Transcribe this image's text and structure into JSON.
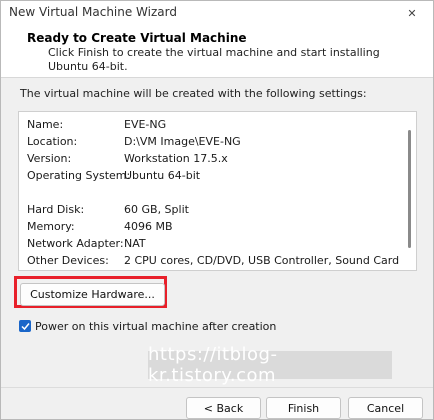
{
  "window": {
    "title": "New Virtual Machine Wizard",
    "close_glyph": "✕"
  },
  "header": {
    "title": "Ready to Create Virtual Machine",
    "subtitle": "Click Finish to create the virtual machine and start installing Ubuntu 64-bit."
  },
  "intro": "The virtual machine will be created with the following settings:",
  "settings": [
    {
      "label": "Name:",
      "value": "EVE-NG"
    },
    {
      "label": "Location:",
      "value": "D:\\VM Image\\EVE-NG"
    },
    {
      "label": "Version:",
      "value": "Workstation 17.5.x"
    },
    {
      "label": "Operating System:",
      "value": "Ubuntu 64-bit"
    },
    {
      "label": "Hard Disk:",
      "value": "60 GB, Split"
    },
    {
      "label": "Memory:",
      "value": "4096 MB"
    },
    {
      "label": "Network Adapter:",
      "value": "NAT"
    },
    {
      "label": "Other Devices:",
      "value": "2 CPU cores, CD/DVD, USB Controller, Sound Card"
    }
  ],
  "customize_label": "Customize Hardware...",
  "power_on": {
    "label": "Power on this virtual machine after creation",
    "checked": true
  },
  "watermark": "https://itblog-kr.tistory.com",
  "buttons": {
    "back": "< Back",
    "finish": "Finish",
    "cancel": "Cancel"
  },
  "colors": {
    "highlight": "#e8202a",
    "checkbox": "#1a66c9"
  }
}
